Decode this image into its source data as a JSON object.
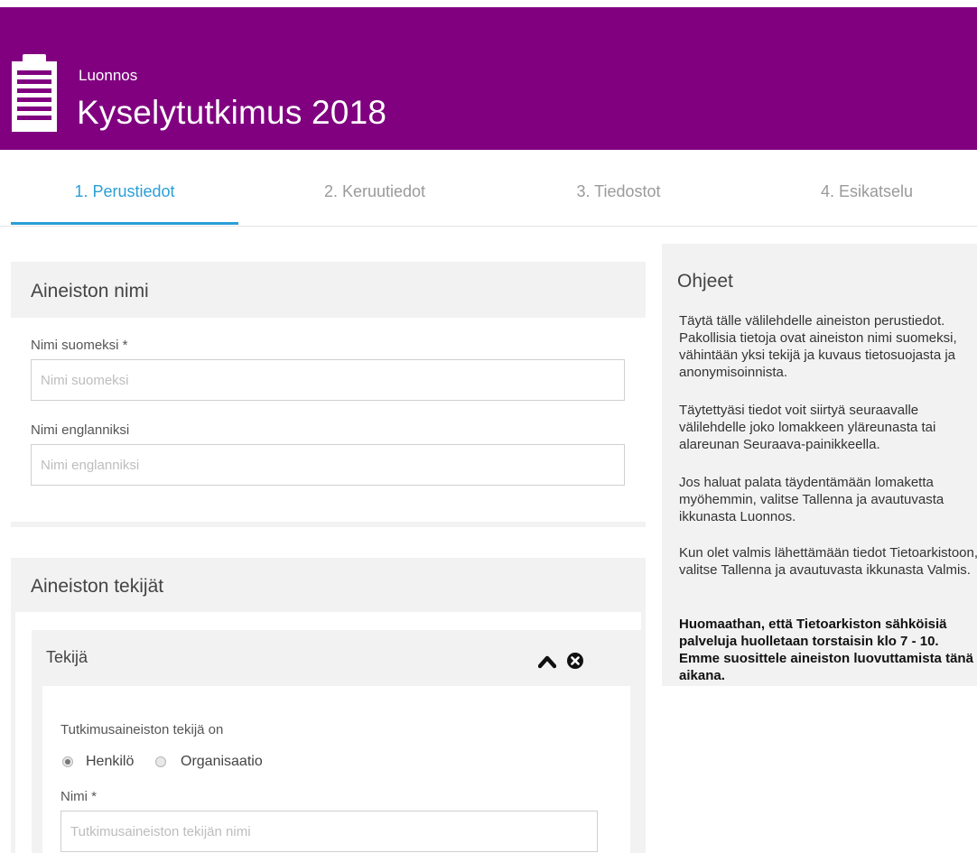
{
  "header": {
    "status": "Luonnos",
    "title": "Kyselytutkimus 2018",
    "background_color": "#800080",
    "icon": "clipboard-icon"
  },
  "tabs": [
    {
      "label": "1. Perustiedot",
      "active": true
    },
    {
      "label": "2. Keruutiedot",
      "active": false
    },
    {
      "label": "3. Tiedostot",
      "active": false
    },
    {
      "label": "4. Esikatselu",
      "active": false
    }
  ],
  "accent_color": "#2a9fd6",
  "dataset_name": {
    "heading": "Aineiston nimi",
    "finnish": {
      "label": "Nimi suomeksi *",
      "placeholder": "Nimi suomeksi",
      "value": ""
    },
    "english": {
      "label": "Nimi englanniksi",
      "placeholder": "Nimi englanniksi",
      "value": ""
    }
  },
  "creators": {
    "heading": "Aineiston tekijät",
    "creator": {
      "heading": "Tekijä",
      "collapse_icon": "chevron-up-icon",
      "remove_icon": "close-circle-icon",
      "type_label": "Tutkimusaineiston tekijä on",
      "options": [
        {
          "label": "Henkilö",
          "selected": true
        },
        {
          "label": "Organisaatio",
          "selected": false
        }
      ],
      "name": {
        "label": "Nimi *",
        "placeholder": "Tutkimusaineiston tekijän nimi",
        "value": ""
      }
    }
  },
  "help": {
    "heading": "Ohjeet",
    "paragraphs": [
      "Täytä tälle välilehdelle aineiston perustiedot. Pakollisia tietoja ovat aineiston nimi suomeksi, vähintään yksi tekijä ja kuvaus tietosuojasta ja anonymisoinnista.",
      "Täytettyäsi tiedot voit siirtyä seuraavalle välilehdelle joko lomakkeen yläreunasta tai alareunan Seuraava-painikkeella.",
      "Jos haluat palata täydentämään lomaketta myöhemmin, valitse Tallenna ja avautuvasta ikkunasta Luonnos.",
      "Kun olet valmis lähettämään tiedot Tietoarkistoon, valitse Tallenna ja avautuvasta ikkunasta Valmis.",
      "Huomaathan, että Tietoarkiston sähköisiä palveluja huolletaan torstaisin klo 7 - 10. Emme suosittele aineiston luovuttamista tänä aikana."
    ]
  }
}
